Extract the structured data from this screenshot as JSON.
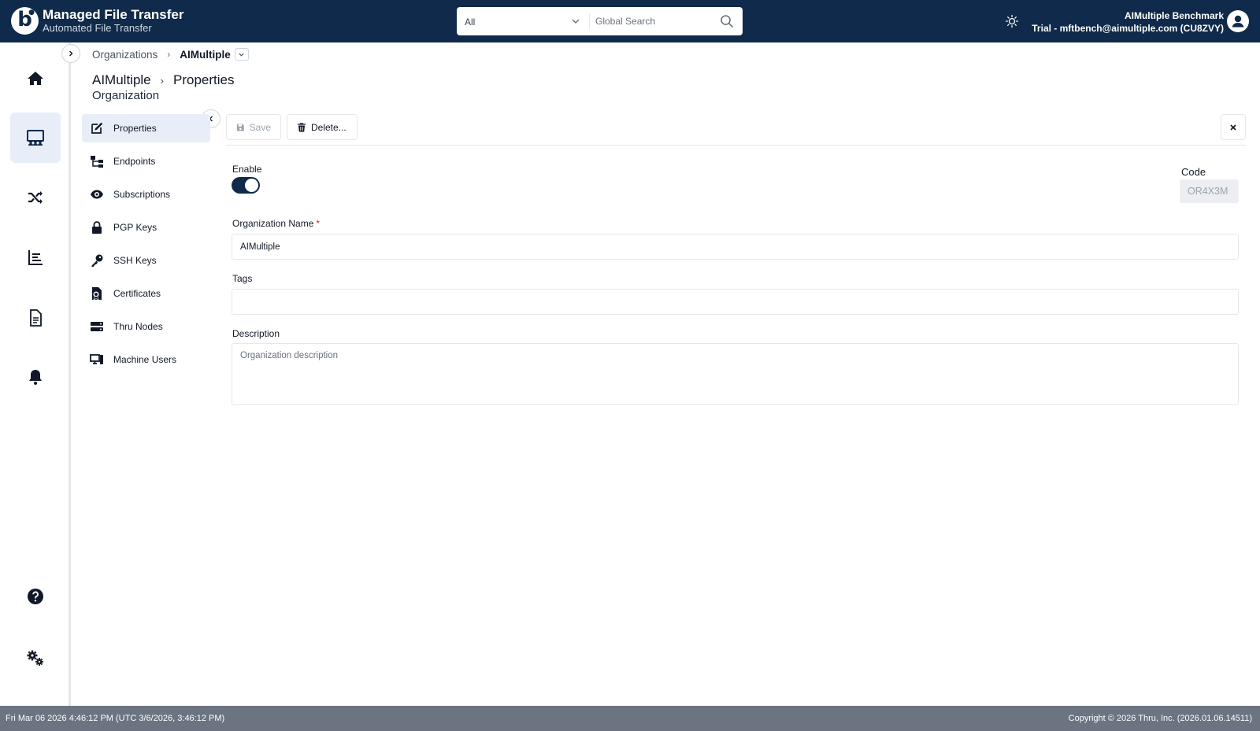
{
  "header": {
    "logo_letter": "b",
    "app_title": "Managed File Transfer",
    "app_subtitle": "Automated File Transfer",
    "search_scope": "All",
    "search_placeholder": "Global Search",
    "user_name": "AIMultiple Benchmark",
    "user_account": "Trial - mftbench@aimultiple.com (CU8ZVY)"
  },
  "rail": {
    "items": [
      {
        "icon": "home-icon",
        "active": false
      },
      {
        "icon": "organizations-icon",
        "active": true
      },
      {
        "icon": "shuffle-icon",
        "active": false
      },
      {
        "icon": "reports-icon",
        "active": false
      },
      {
        "icon": "document-icon",
        "active": false
      },
      {
        "icon": "bell-icon",
        "active": false
      },
      {
        "icon": "help-icon",
        "active": false
      },
      {
        "icon": "settings-icon",
        "active": false
      }
    ]
  },
  "breadcrumb": {
    "parent": "Organizations",
    "current": "AIMultiple"
  },
  "page": {
    "title": "AIMultiple",
    "section": "Properties",
    "subtitle": "Organization"
  },
  "subnav": {
    "items": [
      {
        "label": "Properties",
        "icon": "edit-icon",
        "active": true
      },
      {
        "label": "Endpoints",
        "icon": "endpoints-icon",
        "active": false
      },
      {
        "label": "Subscriptions",
        "icon": "eye-icon",
        "active": false
      },
      {
        "label": "PGP Keys",
        "icon": "lock-icon",
        "active": false
      },
      {
        "label": "SSH Keys",
        "icon": "key-icon",
        "active": false
      },
      {
        "label": "Certificates",
        "icon": "certificate-icon",
        "active": false
      },
      {
        "label": "Thru Nodes",
        "icon": "server-icon",
        "active": false
      },
      {
        "label": "Machine Users",
        "icon": "computer-icon",
        "active": false
      }
    ]
  },
  "toolbar": {
    "save_label": "Save",
    "delete_label": "Delete..."
  },
  "form": {
    "enable_label": "Enable",
    "enable_value": true,
    "code_label": "Code",
    "code_value": "OR4X3M",
    "name_label": "Organization Name",
    "name_required": "*",
    "name_value": "AIMultiple",
    "tags_label": "Tags",
    "tags_value": "",
    "description_label": "Description",
    "description_placeholder": "Organization description"
  },
  "footer": {
    "datetime": "Fri Mar 06 2026 4:46:12 PM (UTC 3/6/2026, 3:46:12 PM)",
    "copyright": "Copyright © 2026 Thru, Inc. (2026.01.06.14511)"
  },
  "colors": {
    "header_bg": "#0f2a4a",
    "active_bg": "#e8eef8",
    "footer_bg": "#6b7480",
    "required": "#dc2626"
  }
}
